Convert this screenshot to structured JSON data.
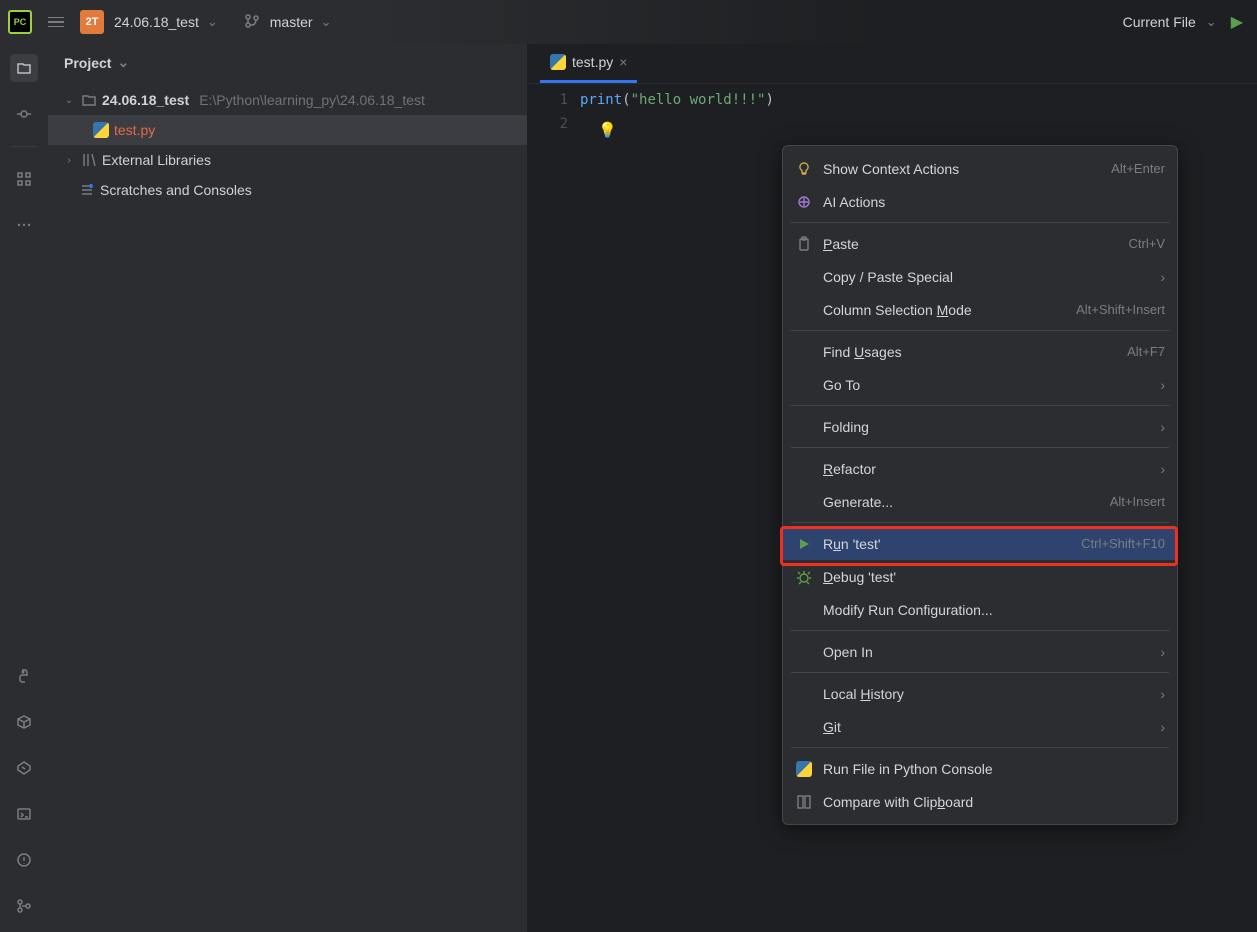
{
  "titlebar": {
    "logo": "PC",
    "badge": "2T",
    "project": "24.06.18_test",
    "branch": "master",
    "runConfig": "Current File"
  },
  "projectPanel": {
    "title": "Project",
    "root": {
      "label": "24.06.18_test",
      "path": "E:\\Python\\learning_py\\24.06.18_test"
    },
    "file": "test.py",
    "external": "External Libraries",
    "scratches": "Scratches and Consoles"
  },
  "tabs": {
    "file": "test.py"
  },
  "code": {
    "lines": [
      "1",
      "2"
    ],
    "fn": "print",
    "str": "\"hello world!!!\""
  },
  "contextMenu": {
    "items": [
      {
        "icon": "bulb",
        "label": "Show Context Actions",
        "shortcut": "Alt+Enter"
      },
      {
        "icon": "ai",
        "label": "AI Actions",
        "shortcut": ""
      },
      {
        "sep": true
      },
      {
        "icon": "paste",
        "label": "Paste",
        "u": 0,
        "shortcut": "Ctrl+V"
      },
      {
        "icon": "",
        "label": "Copy / Paste Special",
        "arrow": true
      },
      {
        "icon": "",
        "label": "Column Selection Mode",
        "u": 17,
        "shortcut": "Alt+Shift+Insert"
      },
      {
        "sep": true
      },
      {
        "icon": "",
        "label": "Find Usages",
        "u": 5,
        "shortcut": "Alt+F7"
      },
      {
        "icon": "",
        "label": "Go To",
        "arrow": true
      },
      {
        "sep": true
      },
      {
        "icon": "",
        "label": "Folding",
        "arrow": true
      },
      {
        "sep": true
      },
      {
        "icon": "",
        "label": "Refactor",
        "u": 0,
        "arrow": true
      },
      {
        "icon": "",
        "label": "Generate...",
        "shortcut": "Alt+Insert"
      },
      {
        "sep": true
      },
      {
        "icon": "run",
        "label": "Run 'test'",
        "u": 1,
        "shortcut": "Ctrl+Shift+F10",
        "highlighted": true
      },
      {
        "icon": "debug",
        "label": "Debug 'test'",
        "u": 0
      },
      {
        "icon": "",
        "label": "Modify Run Configuration..."
      },
      {
        "sep": true
      },
      {
        "icon": "",
        "label": "Open In",
        "arrow": true
      },
      {
        "sep": true
      },
      {
        "icon": "",
        "label": "Local History",
        "u": 6,
        "arrow": true
      },
      {
        "icon": "",
        "label": "Git",
        "u": 0,
        "arrow": true
      },
      {
        "sep": true
      },
      {
        "icon": "py",
        "label": "Run File in Python Console"
      },
      {
        "icon": "compare",
        "label": "Compare with Clipboard",
        "u": 17
      }
    ]
  }
}
